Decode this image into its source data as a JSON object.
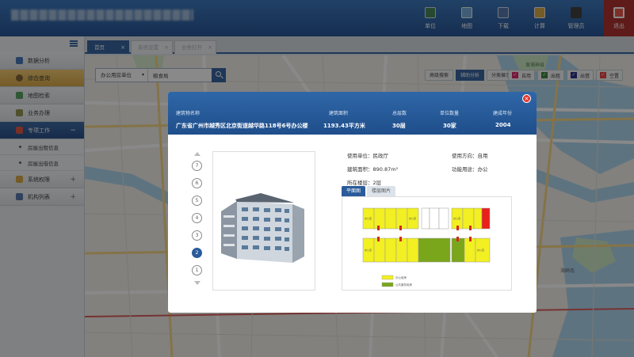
{
  "header": {
    "nav": [
      {
        "label": "单位",
        "icon": "building-icon"
      },
      {
        "label": "地图",
        "icon": "map-icon"
      },
      {
        "label": "下载",
        "icon": "download-icon"
      },
      {
        "label": "计算",
        "icon": "calculator-icon"
      },
      {
        "label": "管理员",
        "icon": "admin-icon"
      },
      {
        "label": "退出",
        "icon": "exit-icon"
      }
    ]
  },
  "sidebar": {
    "items": [
      {
        "label": "数据分析"
      },
      {
        "label": "综合查询"
      },
      {
        "label": "地图检索"
      },
      {
        "label": "业务办理"
      },
      {
        "label": "专项工作",
        "expander": "−"
      },
      {
        "label": "系统权限",
        "expander": "+"
      },
      {
        "label": "机构列表",
        "expander": "+"
      }
    ],
    "subitems": [
      {
        "label": "房屋出租信息"
      },
      {
        "label": "房屋出借信息"
      }
    ]
  },
  "tabs": [
    {
      "label": "首页",
      "close": "×"
    },
    {
      "label": "系统设置",
      "close": "×"
    },
    {
      "label": "业务打开",
      "close": "×"
    }
  ],
  "search": {
    "select_value": "办公用房单位",
    "query": "粮食局"
  },
  "map_buttons": [
    "高级搜索",
    "辅助分析",
    "分类展示"
  ],
  "legend": [
    {
      "label": "自用",
      "color": "#d81b60"
    },
    {
      "label": "出租",
      "color": "#2e7d32"
    },
    {
      "label": "出借",
      "color": "#1a237e"
    },
    {
      "label": "空置",
      "color": "#e53935"
    }
  ],
  "map_labels": {
    "label1": "黄埔神县",
    "label2": "海鸥岛"
  },
  "modal": {
    "close": "×",
    "headers": [
      "建筑物名称",
      "建筑面积",
      "总层数",
      "单位数量",
      "建成年份"
    ],
    "values": [
      "广东省广州市越秀区北京街道越华路118号6号办公楼",
      "1193.43平方米",
      "30层",
      "30家",
      "2004"
    ],
    "floors": [
      "7",
      "6",
      "5",
      "4",
      "3",
      "2",
      "1"
    ],
    "selected_floor": "2",
    "info": {
      "use_unit": "使用单位：民政厅",
      "area": "建筑面积：890.87m²",
      "floor": "所在楼层：2层",
      "direction": "使用方向：自用",
      "function": "功能用途：办公"
    },
    "plan_tabs": [
      "平面图",
      "楼层图片"
    ],
    "plan_legend": [
      "办公用房",
      "公共服务用房"
    ],
    "room_label": "办公室"
  }
}
